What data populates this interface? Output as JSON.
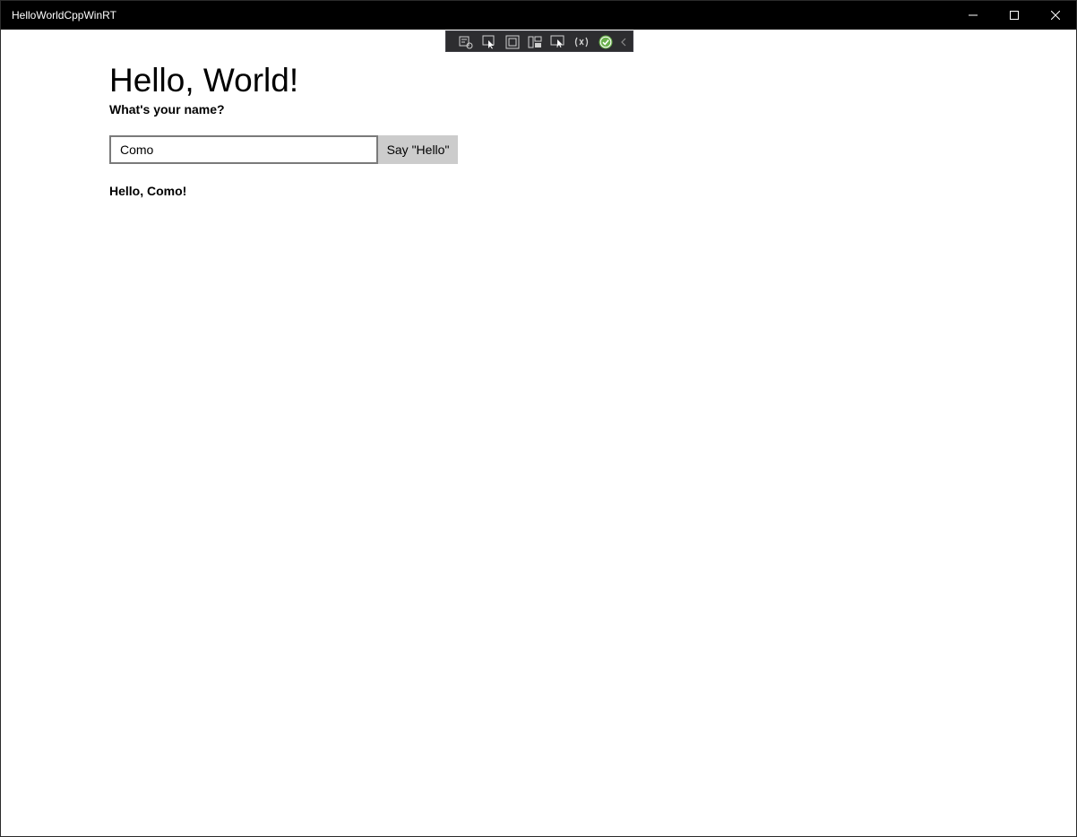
{
  "window": {
    "title": "HelloWorldCppWinRT",
    "controls": [
      "minimize-icon",
      "maximize-icon",
      "close-icon"
    ]
  },
  "debug_toolbar": {
    "icons": [
      "live-visual-tree-icon",
      "select-element-icon",
      "display-layout-adorners-icon",
      "track-focus-icon",
      "preview-selection-icon",
      "xaml-hot-reload-icon",
      "hot-reload-ok-icon",
      "collapse-toolbar-icon"
    ],
    "status_color": "#6ab04c"
  },
  "main": {
    "heading": "Hello, World!",
    "prompt": "What's your name?",
    "name_input_value": "Como",
    "say_button_label": "Say \"Hello\"",
    "greeting": "Hello, Como!"
  }
}
